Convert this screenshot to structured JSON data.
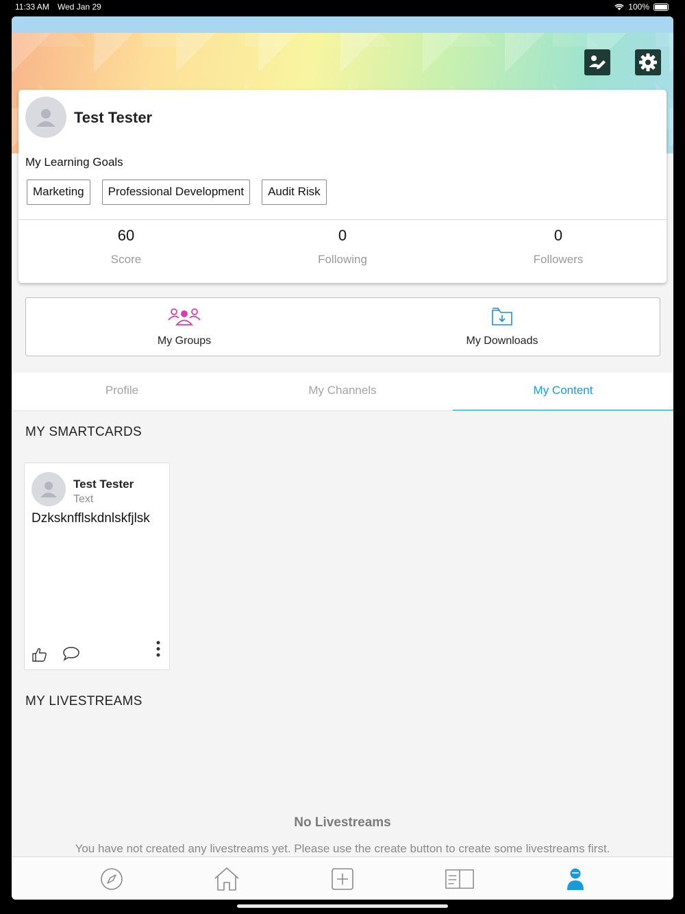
{
  "status_bar": {
    "time": "11:33 AM",
    "date": "Wed Jan 29",
    "battery": "100%"
  },
  "header": {
    "edit_icon": "edit-profile-icon",
    "settings_icon": "gear-icon"
  },
  "profile": {
    "name": "Test Tester",
    "goals_title": "My Learning Goals",
    "goals": [
      "Marketing",
      "Professional Development",
      "Audit Risk"
    ],
    "stats": [
      {
        "value": "60",
        "label": "Score"
      },
      {
        "value": "0",
        "label": "Following"
      },
      {
        "value": "0",
        "label": "Followers"
      }
    ]
  },
  "quick_links": [
    {
      "label": "My Groups",
      "icon": "groups-icon",
      "color": "#d63fae"
    },
    {
      "label": "My Downloads",
      "icon": "download-folder-icon",
      "color": "#1a8fd6"
    }
  ],
  "tabs": [
    {
      "label": "Profile",
      "active": false
    },
    {
      "label": "My Channels",
      "active": false
    },
    {
      "label": "My Content",
      "active": true
    }
  ],
  "smartcards": {
    "title": "MY SMARTCARDS",
    "items": [
      {
        "author": "Test Tester",
        "type": "Text",
        "text": "Dzksknfflskdnlskfjlsk"
      }
    ]
  },
  "livestreams": {
    "title": "MY LIVESTREAMS",
    "empty_title": "No Livestreams",
    "empty_desc": "You have not created any livestreams yet. Please use the create button to create some livestreams first."
  },
  "bottom_nav": [
    {
      "icon": "compass-icon",
      "active": false
    },
    {
      "icon": "home-icon",
      "active": false
    },
    {
      "icon": "create-icon",
      "active": false
    },
    {
      "icon": "book-icon",
      "active": false
    },
    {
      "icon": "person-icon",
      "active": true
    }
  ],
  "colors": {
    "accent": "#1a9ad6",
    "header_button": "#1f3b36"
  }
}
